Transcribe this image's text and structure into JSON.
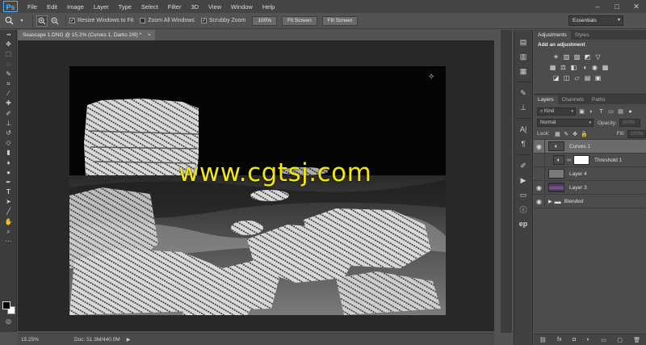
{
  "app": {
    "logo": "Ps"
  },
  "menu": [
    "File",
    "Edit",
    "Image",
    "Layer",
    "Type",
    "Select",
    "Filter",
    "3D",
    "View",
    "Window",
    "Help"
  ],
  "window_controls": {
    "minimize": "–",
    "maximize": "□",
    "close": "✕"
  },
  "options": {
    "resize_windows": {
      "label": "Resize Windows to Fit",
      "checked": true
    },
    "zoom_all": {
      "label": "Zoom All Windows",
      "checked": false
    },
    "scrubby_zoom": {
      "label": "Scrubby Zoom",
      "checked": true
    },
    "btn_100": "100%",
    "btn_fit": "Fit Screen",
    "btn_fill": "Fill Screen",
    "workspace": "Essentials"
  },
  "document": {
    "tab_title": "Seascape 1.DNG @ 15.2% (Curves 1, Darks 2/8) *",
    "tab_close": "×",
    "watermark": "www.cgtsj.com"
  },
  "status": {
    "zoom": "15.25%",
    "doc_size": "Doc: 51.3M/440.0M",
    "arrow": "▶"
  },
  "adjustments": {
    "tabs": [
      "Adjustments",
      "Styles"
    ],
    "title": "Add an adjustment",
    "row1": [
      "☀",
      "▥",
      "▨",
      "◩",
      "▽"
    ],
    "row2": [
      "▦",
      "⚖",
      "◧",
      "◑",
      "◉",
      "▦"
    ],
    "row3": [
      "◪",
      "◫",
      "▱",
      "▤",
      "▣"
    ]
  },
  "layers_panel": {
    "tabs": [
      "Layers",
      "Channels",
      "Paths"
    ],
    "kind_filter": "Kind",
    "blend_mode": "Normal",
    "opacity_label": "Opacity:",
    "opacity_value": "100%",
    "lock_label": "Lock:",
    "fill_label": "Fill:",
    "fill_value": "100%",
    "layers": [
      {
        "name": "Curves 1",
        "visible": true,
        "selected": true
      },
      {
        "name": "Threshold 1",
        "visible": false,
        "selected": false
      },
      {
        "name": "Layer 4",
        "visible": false,
        "selected": false
      },
      {
        "name": "Layer 3",
        "visible": true,
        "selected": false
      },
      {
        "name": "Blended",
        "visible": true,
        "selected": false
      }
    ],
    "footer_icons": [
      "⛓",
      "fx",
      "◘",
      "◐",
      "▭",
      "▢",
      "🗑"
    ]
  },
  "colors": {
    "watermark": "#f2e80c",
    "accent": "#5ab0ff"
  }
}
